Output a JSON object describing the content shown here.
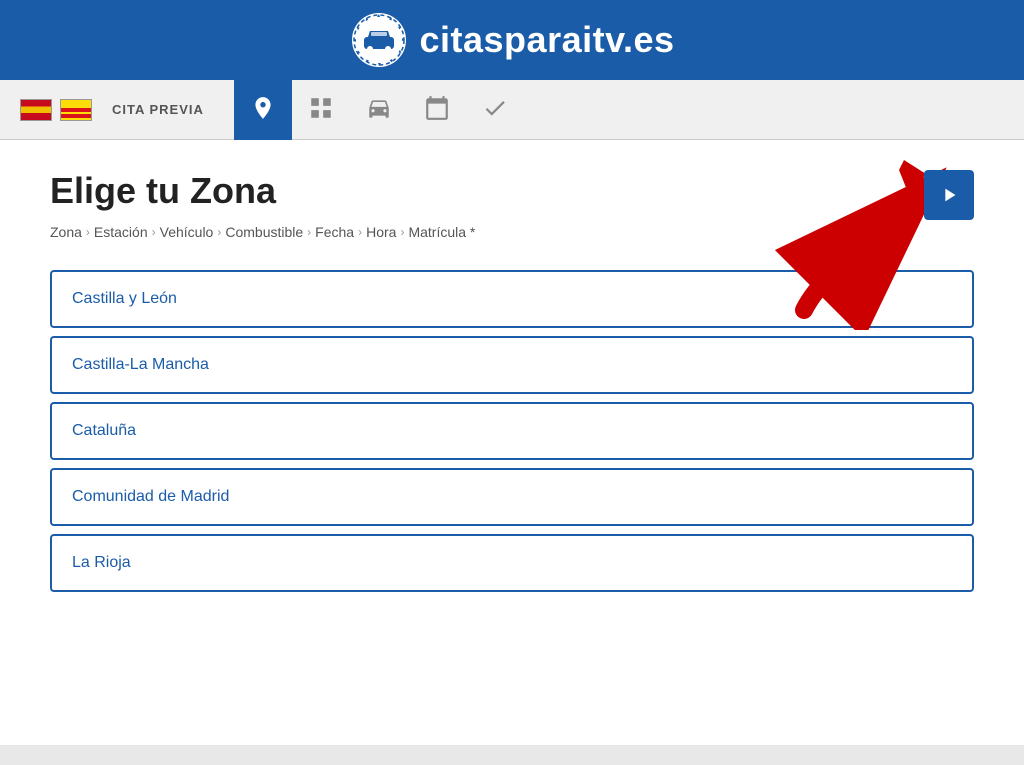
{
  "header": {
    "logo_alt": "citasparaitv logo",
    "title": "citasparaitv.es"
  },
  "navbar": {
    "cita_previa_label": "CITA PREVIA",
    "tabs": [
      {
        "id": "location",
        "icon": "📍",
        "active": true
      },
      {
        "id": "grid",
        "icon": "⊞",
        "active": false
      },
      {
        "id": "car",
        "icon": "🚗",
        "active": false
      },
      {
        "id": "calendar",
        "icon": "📅",
        "active": false
      },
      {
        "id": "check",
        "icon": "✔",
        "active": false
      }
    ]
  },
  "page": {
    "title": "Elige tu Zona",
    "breadcrumb": [
      {
        "label": "Zona",
        "active": false
      },
      {
        "label": "Estación",
        "active": false
      },
      {
        "label": "Vehículo",
        "active": false
      },
      {
        "label": "Combustible",
        "active": false
      },
      {
        "label": "Fecha",
        "active": false
      },
      {
        "label": "Hora",
        "active": false
      },
      {
        "label": "Matrícula *",
        "active": false
      }
    ],
    "next_button_label": "→"
  },
  "zones": [
    {
      "id": "castilla-leon",
      "label": "Castilla y León"
    },
    {
      "id": "castilla-la-mancha",
      "label": "Castilla-La Mancha"
    },
    {
      "id": "cataluna",
      "label": "Cataluña"
    },
    {
      "id": "comunidad-madrid",
      "label": "Comunidad de Madrid"
    },
    {
      "id": "la-rioja",
      "label": "La Rioja"
    }
  ]
}
